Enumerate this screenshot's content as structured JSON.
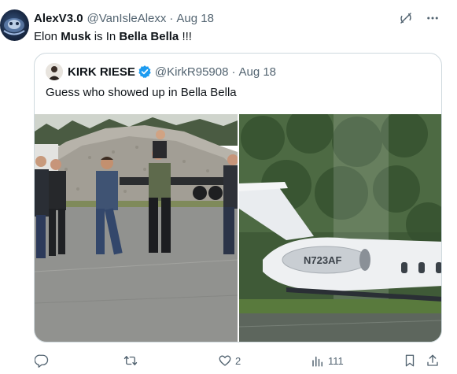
{
  "tweet": {
    "display_name": "AlexV3.0",
    "handle": "@VanIsleAlexx",
    "separator": "·",
    "date": "Aug 18",
    "text_parts": {
      "p1": "Elon ",
      "p2": "Musk",
      "p3": " is In ",
      "p4": "Bella Bella",
      "p5": " !!!"
    }
  },
  "quoted_tweet": {
    "display_name": "KIRK RIESE",
    "verified": true,
    "handle": "@KirkR95908",
    "separator": "·",
    "date": "Aug 18",
    "text": "Guess who showed up in Bella Bella",
    "media": [
      {
        "icon": "photo-people-on-tarmac"
      },
      {
        "icon": "photo-private-jet"
      },
      {
        "tail_number": "N723AF"
      }
    ]
  },
  "actions": {
    "reply": {
      "icon": "reply-icon",
      "count": ""
    },
    "retweet": {
      "icon": "retweet-icon",
      "count": ""
    },
    "like": {
      "icon": "heart-icon",
      "count": "2"
    },
    "views": {
      "icon": "views-icon",
      "count": "111"
    },
    "bookmark": {
      "icon": "bookmark-icon"
    },
    "share": {
      "icon": "share-icon"
    }
  },
  "colors": {
    "text": "#0f1419",
    "secondary": "#536471",
    "border": "#cfd9de",
    "verified": "#1d9bf0"
  }
}
